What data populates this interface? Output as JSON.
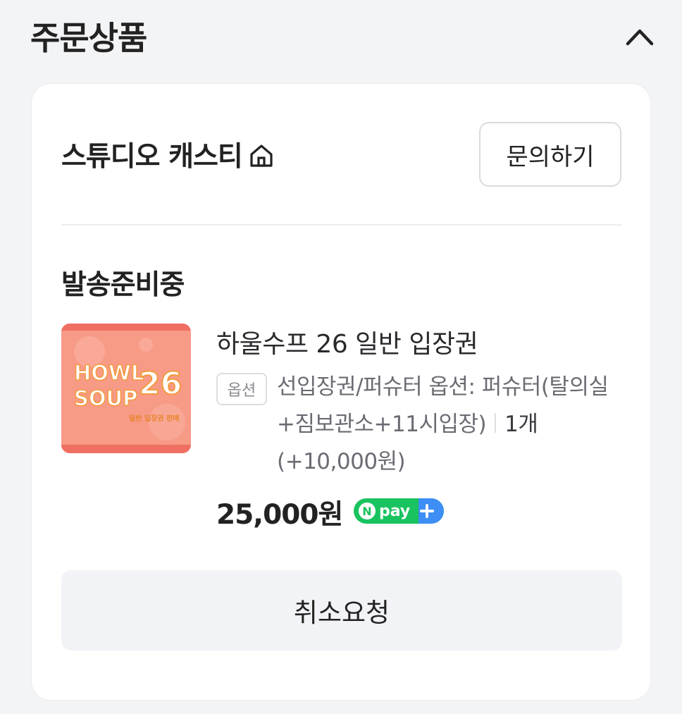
{
  "section": {
    "title": "주문상품"
  },
  "store": {
    "name": "스튜디오 캐스티",
    "inquiry_label": "문의하기"
  },
  "order": {
    "status": "발송준비중",
    "product_name": "하울수프 26 일반 입장권",
    "thumbnail_text": {
      "line1": "HOWL",
      "line2": "SOUP",
      "number": "26",
      "caption": "일반 입장권 판매"
    },
    "option_badge": "옵션",
    "option_text": "선입장권/퍼슈터 옵션: 퍼슈터(탈의실+짐보관소+11시입장)",
    "quantity": "1개",
    "option_price": "(+10,000원)",
    "price": "25,000원",
    "pay_badge": {
      "label": "pay",
      "logo_letter": "N"
    }
  },
  "actions": {
    "cancel_label": "취소요청"
  },
  "colors": {
    "npay_green": "#19c35f",
    "npay_blue": "#3d8ef5",
    "thumb_bg": "#f5907d",
    "thumb_text": "#ffffff",
    "thumb_orange": "#f39a3e"
  }
}
